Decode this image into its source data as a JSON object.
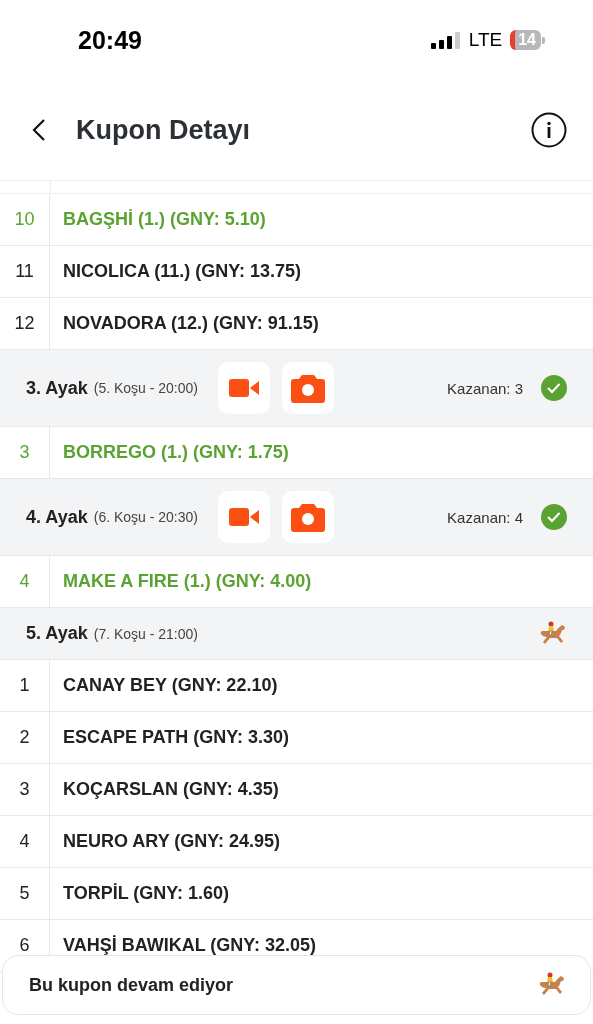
{
  "status_bar": {
    "time": "20:49",
    "network": "LTE",
    "battery": "14"
  },
  "header": {
    "title": "Kupon Detayı"
  },
  "items": [
    {
      "kind": "runner",
      "number": "10",
      "name": "BAGŞHİ (1.) (GNY: 5.10)",
      "won": true
    },
    {
      "kind": "runner",
      "number": "11",
      "name": "NICOLICA (11.) (GNY: 13.75)",
      "won": false
    },
    {
      "kind": "runner",
      "number": "12",
      "name": "NOVADORA (12.) (GNY: 91.15)",
      "won": false
    },
    {
      "kind": "leg",
      "title": "3. Ayak",
      "detail": "(5. Koşu - 20:00)",
      "media": true,
      "winner": "Kazanan: 3",
      "settled": true
    },
    {
      "kind": "runner",
      "number": "3",
      "name": "BORREGO (1.) (GNY: 1.75)",
      "won": true
    },
    {
      "kind": "leg",
      "title": "4. Ayak",
      "detail": "(6. Koşu - 20:30)",
      "media": true,
      "winner": "Kazanan: 4",
      "settled": true
    },
    {
      "kind": "runner",
      "number": "4",
      "name": "MAKE A FIRE (1.) (GNY: 4.00)",
      "won": true
    },
    {
      "kind": "leg",
      "title": "5. Ayak",
      "detail": "(7. Koşu - 21:00)",
      "media": false,
      "settled": false
    },
    {
      "kind": "runner",
      "number": "1",
      "name": "CANAY BEY (GNY: 22.10)",
      "won": false
    },
    {
      "kind": "runner",
      "number": "2",
      "name": "ESCAPE PATH (GNY: 3.30)",
      "won": false
    },
    {
      "kind": "runner",
      "number": "3",
      "name": "KOÇARSLAN (GNY: 4.35)",
      "won": false
    },
    {
      "kind": "runner",
      "number": "4",
      "name": "NEURO ARY (GNY: 24.95)",
      "won": false
    },
    {
      "kind": "runner",
      "number": "5",
      "name": "TORPİL (GNY: 1.60)",
      "won": false
    },
    {
      "kind": "runner",
      "number": "6",
      "name": "VAHŞİ BAWIKAL (GNY: 32.05)",
      "won": false
    }
  ],
  "footer": {
    "text": "Bu kupon devam ediyor",
    "in_progress": true
  }
}
